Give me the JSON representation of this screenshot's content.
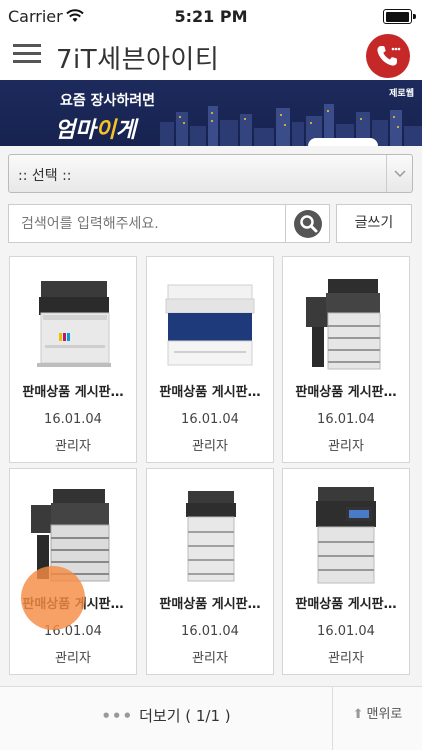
{
  "status": {
    "carrier": "Carrier",
    "time": "5:21 PM"
  },
  "header": {
    "title": "7iT세븐아이티"
  },
  "banner": {
    "line1": "요즘 장사하려면",
    "line2_part1": "엄마",
    "line2_highlight": "이",
    "line2_part2": "게",
    "brand": "제로웹"
  },
  "select": {
    "label": ":: 선택 ::"
  },
  "search": {
    "placeholder": "검색어를 입력해주세요.",
    "write_label": "글쓰기"
  },
  "products": [
    {
      "title": "판매상품 게시판…",
      "date": "16.01.04",
      "author": "관리자"
    },
    {
      "title": "판매상품 게시판…",
      "date": "16.01.04",
      "author": "관리자"
    },
    {
      "title": "판매상품 게시판…",
      "date": "16.01.04",
      "author": "관리자"
    },
    {
      "title": "판매상품 게시판…",
      "date": "16.01.04",
      "author": "관리자"
    },
    {
      "title": "판매상품 게시판…",
      "date": "16.01.04",
      "author": "관리자"
    },
    {
      "title": "판매상품 게시판…",
      "date": "16.01.04",
      "author": "관리자"
    }
  ],
  "footer": {
    "more_label": "더보기 ( 1/1 )",
    "top_label": "맨위로"
  },
  "colors": {
    "call": "#c62828",
    "banner": "#1d2a5c",
    "touch": "#f58c46"
  }
}
